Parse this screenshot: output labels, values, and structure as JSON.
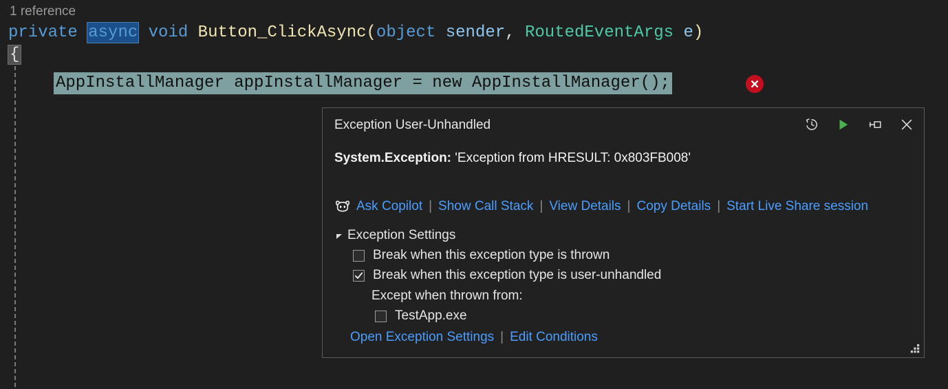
{
  "editor": {
    "codelens": "1 reference",
    "signature": {
      "kw_private": "private",
      "kw_async": "async",
      "kw_void": "void",
      "method_name": "Button_ClickAsync",
      "paren_open": "(",
      "type_object": "object",
      "param_sender": "sender",
      "comma": ",",
      "type_routedeventargs": "RoutedEventArgs",
      "param_e": "e",
      "paren_close": ")"
    },
    "open_brace": "{",
    "statement_line": "AppInstallManager appInstallManager = new AppInstallManager();",
    "error_glyph_name": "error-icon"
  },
  "popup": {
    "title": "Exception User-Unhandled",
    "toolbar": [
      {
        "name": "exception-history-icon",
        "label": "View exception history"
      },
      {
        "name": "continue-play-icon",
        "label": "Continue"
      },
      {
        "name": "pin-icon",
        "label": "Pin"
      },
      {
        "name": "close-icon",
        "label": "Close"
      }
    ],
    "message": {
      "exception_type": "System.Exception:",
      "exception_text": "'Exception from HRESULT: 0x803FB008'"
    },
    "action_links": [
      {
        "name": "ask-copilot-link",
        "label": "Ask Copilot",
        "icon": "copilot-icon"
      },
      {
        "name": "show-call-stack-link",
        "label": "Show Call Stack"
      },
      {
        "name": "view-details-link",
        "label": "View Details"
      },
      {
        "name": "copy-details-link",
        "label": "Copy Details"
      },
      {
        "name": "start-live-share-link",
        "label": "Start Live Share session"
      }
    ],
    "link_separator": "|",
    "settings": {
      "header": "Exception Settings",
      "expanded": true,
      "options": [
        {
          "name": "break-when-thrown-checkbox",
          "label": "Break when this exception type is thrown",
          "checked": false
        },
        {
          "name": "break-when-user-unhandled-checkbox",
          "label": "Break when this exception type is user-unhandled",
          "checked": true
        }
      ],
      "except_when_label": "Except when thrown from:",
      "except_modules": [
        {
          "name": "module-testapp-checkbox",
          "label": "TestApp.exe",
          "checked": false
        }
      ]
    },
    "bottom_links": [
      {
        "name": "open-exception-settings-link",
        "label": "Open Exception Settings"
      },
      {
        "name": "edit-conditions-link",
        "label": "Edit Conditions"
      }
    ]
  },
  "colors": {
    "editor_background": "#1f1f1f",
    "popup_background": "#212121",
    "popup_border": "#5a5a5a",
    "link": "#4a9eff",
    "error_red": "#c50f1f",
    "play_green": "#4caf50",
    "statement_highlight": "#7fa0a0",
    "keyword_blue": "#569cd6",
    "type_green": "#4ec9a8",
    "method_yellow": "#f0e4b0"
  }
}
